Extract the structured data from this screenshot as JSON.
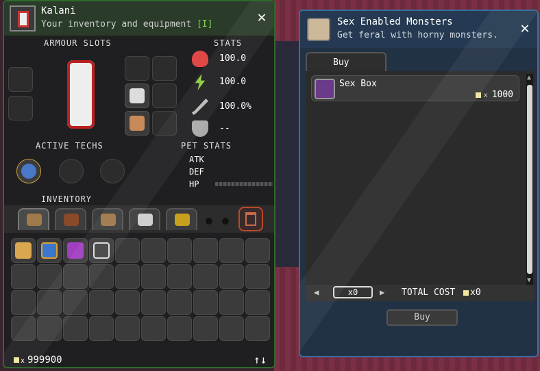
{
  "inventory_panel": {
    "title": "Kalani",
    "subtitle": "Your inventory and equipment",
    "subtitle_hotkey": "[I]",
    "close_label": "✕",
    "armour_slots_label": "ARMOUR SLOTS",
    "stats_label": "STATS",
    "stats": {
      "health": "100.0",
      "energy": "100.0",
      "attack": "100.0%",
      "defense": "--"
    },
    "active_techs_label": "ACTIVE TECHS",
    "pet_stats_label": "PET STATS",
    "pet_stats": {
      "atk": "ATK",
      "def": "DEF",
      "hp": "HP"
    },
    "inventory_label": "INVENTORY",
    "tabs": [
      {
        "icon": "bag-icon",
        "color": "#a07a4a"
      },
      {
        "icon": "book-icon",
        "color": "#8a4a2a"
      },
      {
        "icon": "furniture-icon",
        "color": "#a0784a"
      },
      {
        "icon": "wrench-icon",
        "color": "#cfcfcf"
      },
      {
        "icon": "food-icon",
        "color": "#c8a020"
      }
    ],
    "pixels": "999900",
    "sort_label": "↑↓"
  },
  "shop_panel": {
    "title": "Sex Enabled Monsters",
    "subtitle": "Get feral with horny monsters.",
    "close_label": "✕",
    "tab_label": "Buy",
    "items": [
      {
        "name": "Sex Box",
        "price": "1000"
      }
    ],
    "quantity": "x0",
    "total_cost_label": "TOTAL COST",
    "total_cost_value": "x0",
    "buy_button": "Buy"
  }
}
